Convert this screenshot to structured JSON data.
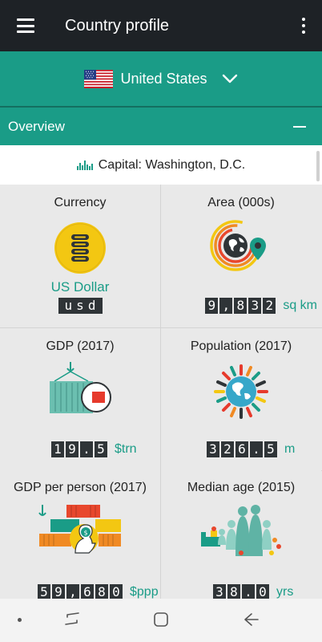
{
  "app_bar": {
    "title": "Country profile"
  },
  "country": {
    "name": "United States"
  },
  "section": {
    "title": "Overview"
  },
  "capital": {
    "text": "Capital: Washington, D.C."
  },
  "stats": {
    "currency": {
      "label": "Currency",
      "value": "US Dollar",
      "code": "usd"
    },
    "area": {
      "label": "Area (000s)",
      "digits": [
        "9",
        ",",
        "8",
        "3",
        "2"
      ],
      "unit": "sq km"
    },
    "gdp": {
      "label": "GDP (2017)",
      "digits": [
        "1",
        "9",
        ".",
        "5"
      ],
      "unit": "$trn"
    },
    "population": {
      "label": "Population (2017)",
      "digits": [
        "3",
        "2",
        "6",
        ".",
        "5"
      ],
      "unit": "m"
    },
    "gdp_per_person": {
      "label": "GDP per person (2017)",
      "digits": [
        "5",
        "9",
        ",",
        "6",
        "8",
        "0"
      ],
      "unit": "$ppp"
    },
    "median_age": {
      "label": "Median age (2015)",
      "digits": [
        "3",
        "8",
        ".",
        "0"
      ],
      "unit": "yrs"
    }
  },
  "colors": {
    "teal": "#1a9c87",
    "dark": "#1e2226",
    "counter_bg": "#2f3437",
    "gold": "#f3c712"
  },
  "icons": [
    "menu-icon",
    "more-icon",
    "us-flag-icon",
    "chevron-down-icon",
    "collapse-icon",
    "capital-skyline-icon",
    "coin-stack-icon",
    "globe-pin-icon",
    "shipping-container-icon",
    "people-globe-icon",
    "containers-person-icon",
    "family-icon",
    "recent-apps-icon",
    "home-icon",
    "back-icon"
  ]
}
